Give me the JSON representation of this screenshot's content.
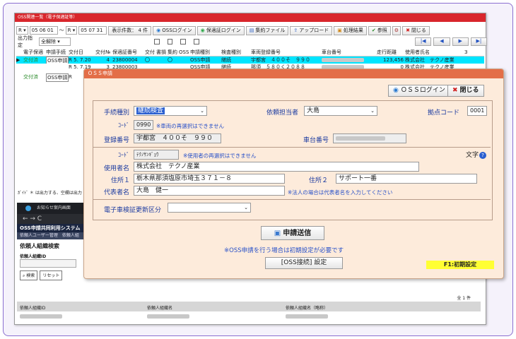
{
  "list_window": {
    "title": "OSS関連一覧（電子保適証等）",
    "toolbar": {
      "from_era": "R",
      "from_date": "05 06 01",
      "range_sep": "～",
      "to_era": "R",
      "to_date": "05 07 31",
      "count_label": "表示件数： 4 件",
      "oss_login": "OSSログイン",
      "hoseki_login": "保適証ログイン",
      "aggregate_file": "集約ファイル",
      "upload": "アップロード",
      "result": "処理結果",
      "reference": "参照",
      "close": "閉じる"
    },
    "output_label": "出力指定",
    "output_value": "全解除",
    "columns": [
      "電子保適",
      "申請手続",
      "交付日",
      "交付№",
      "保適証番号",
      "交付",
      "書損",
      "集約",
      "OSS",
      "申請種別",
      "検査種別",
      "車両登録番号",
      "車台番号",
      "走行距離",
      "使用者氏名",
      "З"
    ],
    "rows": [
      {
        "status": "交付済",
        "proc": "OSS申請",
        "era": "R",
        "date": "5. 7.20",
        "no": "4",
        "cert": "23800004",
        "mark1": "〇",
        "mark2": "〇",
        "oss": "OSS申請",
        "type": "継続",
        "plate": "宇都宮　４００そ　９９０",
        "dist": "123,456",
        "user": "株式会社　テクノ産業",
        "selected": true
      },
      {
        "status": "",
        "proc": "",
        "era": "R",
        "date": "5. 7.19",
        "no": "3",
        "cert": "23800003",
        "mark1": "",
        "mark2": "",
        "oss": "OSS申請",
        "type": "継続",
        "plate": "那須　５８０く２０８８",
        "dist": "0",
        "user": "株式会社　テクノ産業",
        "selected": false
      },
      {
        "status": "交付済",
        "proc": "OSS申請",
        "era": "R",
        "date": "",
        "no": "",
        "cert": "",
        "mark1": "",
        "mark2": "",
        "oss": "",
        "type": "",
        "plate": "",
        "dist": "",
        "user": "",
        "selected": false
      }
    ],
    "footer_note": "ｶﾞｲﾄﾞ ＊ は出力する、空欄は出力"
  },
  "browser_window": {
    "tab_title": "お知らせ案内画面",
    "nav": "←  →  C",
    "app_title": "OSS申請共同利用システム（ 6",
    "sub_tabs": "依頼人ユーザー管理　依頼人組",
    "section_title": "依頼人組織検索",
    "id_label": "依頼人組織ID",
    "search_btn": "検索",
    "reset_btn": "リセット",
    "count": "全 1 件",
    "col1": "依頼人組織ID",
    "col2": "依頼人組織名",
    "col3": "依頼人組織名（略称）"
  },
  "dialog": {
    "title": "ＯＳＳ申請",
    "oss_login": "ＯＳＳログイン",
    "close": "閉じる",
    "proc_type_label": "手続種別",
    "proc_type_value": "継続検査",
    "assignee_label": "依頼担当者",
    "assignee_value": "大島",
    "base_code_label": "拠点コード",
    "base_code_value": "0001",
    "code1_label": "ｺｰﾄﾞ",
    "code1_value": "0990",
    "code1_note": "※車両の再選択はできません",
    "reg_no_label": "登録番号",
    "reg_no_value": "宇都宮　４００そ　９９０",
    "chassis_label": "車台番号",
    "code2_label": "ｺｰﾄﾞ",
    "code2_value": "ﾃｸﾉｻﾝｷﾞｮｳ",
    "code2_note": "※使用者の再選択はできません",
    "moji_label": "文字",
    "user_name_label": "使用者名",
    "user_name_value": "株式会社　テクノ産業",
    "addr1_label": "住所１",
    "addr1_value": "栃木県那須塩原市埼玉３７１－８",
    "addr2_label": "住所２",
    "addr2_value": "サポート一番",
    "rep_label": "代表者名",
    "rep_value": "大島　健一",
    "rep_note": "※法人の場合は代表者名を入力してください",
    "ecert_label": "電子車検証更新区分",
    "ecert_value": "",
    "submit": "申請送信",
    "init_note": "※OSS申請を行う場合は初期設定が必要です",
    "oss_setting": "[OSS接続] 設定",
    "f1": "F1:初期設定"
  },
  "colors": {
    "frame_border": "#8b6fd0",
    "list_title": "#d9262c",
    "dialog_title": "#e36e48",
    "dialog_bg": "#fdebdb",
    "label_blue": "#1a3aa0",
    "note_blue": "#2850c8",
    "selected_row": "#00e5ff",
    "f1_badge": "#ffff33"
  }
}
